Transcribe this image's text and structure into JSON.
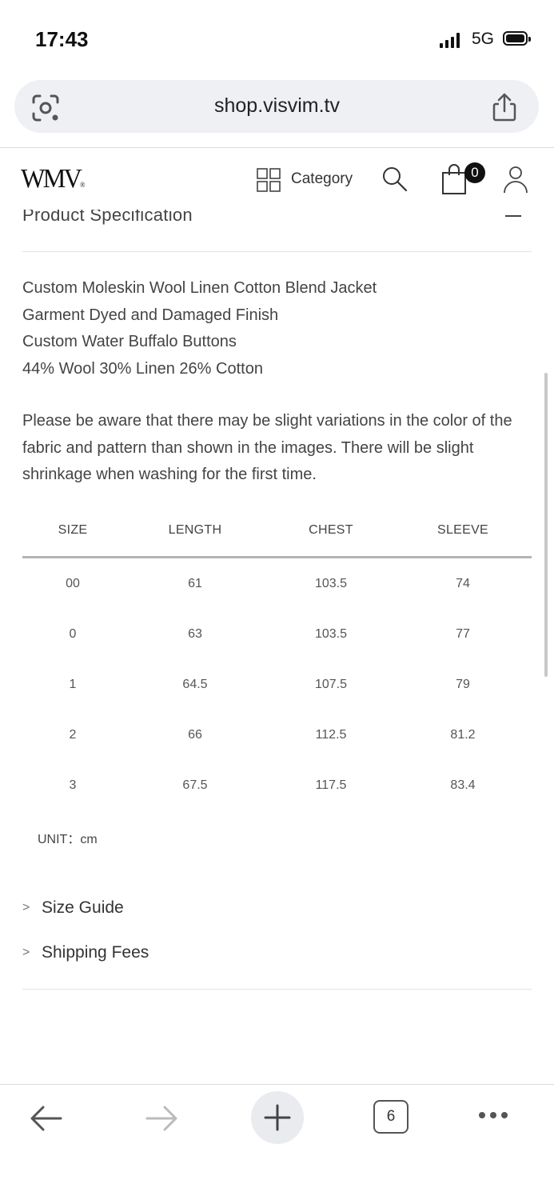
{
  "status_bar": {
    "time": "17:43",
    "network": "5G"
  },
  "browser": {
    "url": "shop.visvim.tv",
    "tab_count": "6"
  },
  "site_header": {
    "logo_text": "WMV",
    "logo_mark": "®",
    "category_label": "Category",
    "cart_count": "0"
  },
  "section": {
    "title": "Product Specification",
    "description_lines": [
      "Custom Moleskin Wool Linen Cotton Blend Jacket",
      "Garment Dyed and Damaged Finish",
      "Custom Water Buffalo Buttons",
      "44% Wool 30% Linen 26% Cotton"
    ],
    "note": "Please be aware that there may be slight variations in the color of the fabric and pattern than shown in the images. There will be slight shrinkage when washing for the first time."
  },
  "size_table": {
    "headers": [
      "SIZE",
      "LENGTH",
      "CHEST",
      "SLEEVE"
    ],
    "rows": [
      [
        "00",
        "61",
        "103.5",
        "74"
      ],
      [
        "0",
        "63",
        "103.5",
        "77"
      ],
      [
        "1",
        "64.5",
        "107.5",
        "79"
      ],
      [
        "2",
        "66",
        "112.5",
        "81.2"
      ],
      [
        "3",
        "67.5",
        "117.5",
        "83.4"
      ]
    ],
    "unit": "UNIT：cm"
  },
  "links": [
    "Size Guide",
    "Shipping Fees"
  ],
  "icons": {
    "lens": "google-lens-icon",
    "share": "share-icon",
    "category": "grid-icon",
    "search": "search-icon",
    "cart": "shopping-bag-icon",
    "user": "user-icon",
    "back": "arrow-left-icon",
    "forward": "arrow-right-icon",
    "new_tab": "plus-icon",
    "more": "more-dots-icon"
  }
}
